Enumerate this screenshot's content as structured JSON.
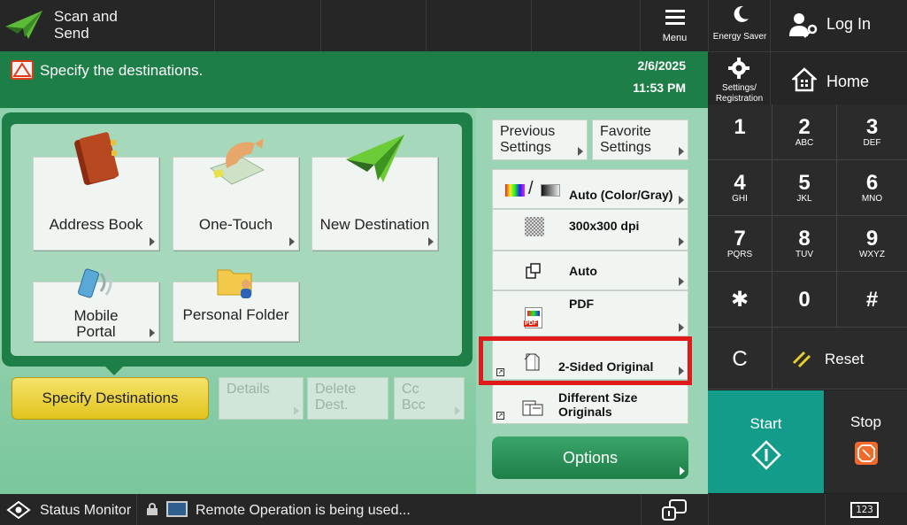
{
  "topbar": {
    "app_title_line1": "Scan and",
    "app_title_line2": "Send",
    "menu_label": "Menu",
    "energy_label": "Energy Saver",
    "login_label": "Log In",
    "settings_label_line1": "Settings/",
    "settings_label_line2": "Registration",
    "home_label": "Home"
  },
  "header": {
    "message": "Specify the destinations.",
    "date": "2/6/2025",
    "time": "11:53 PM"
  },
  "destinations": {
    "tiles": [
      {
        "label": "Address Book"
      },
      {
        "label": "One-Touch"
      },
      {
        "label": "New Destination"
      },
      {
        "label_line1": "Mobile",
        "label_line2": "Portal"
      },
      {
        "label": "Personal Folder"
      }
    ],
    "specify_label": "Specify Destinations",
    "details_label": "Details",
    "delete_line1": "Delete",
    "delete_line2": "Dest.",
    "cc_line1": "Cc",
    "cc_line2": "Bcc"
  },
  "settings": {
    "previous_line1": "Previous",
    "previous_line2": "Settings",
    "favorite_line1": "Favorite",
    "favorite_line2": "Settings",
    "color": "Auto (Color/Gray)",
    "resolution": "300x300 dpi",
    "size": "Auto",
    "format": "PDF",
    "format_icon_text": "PDF",
    "sided": "2-Sided Original",
    "diff_size": "Different Size Originals",
    "options": "Options"
  },
  "keypad": {
    "keys": [
      {
        "d": "1",
        "s": ""
      },
      {
        "d": "2",
        "s": "ABC"
      },
      {
        "d": "3",
        "s": "DEF"
      },
      {
        "d": "4",
        "s": "GHI"
      },
      {
        "d": "5",
        "s": "JKL"
      },
      {
        "d": "6",
        "s": "MNO"
      },
      {
        "d": "7",
        "s": "PQRS"
      },
      {
        "d": "8",
        "s": "TUV"
      },
      {
        "d": "9",
        "s": "WXYZ"
      },
      {
        "d": "✱",
        "s": ""
      },
      {
        "d": "0",
        "s": ""
      },
      {
        "d": "#",
        "s": ""
      }
    ],
    "clear": "C",
    "reset": "Reset",
    "start": "Start",
    "stop": "Stop"
  },
  "status": {
    "monitor": "Status Monitor",
    "message": "Remote Operation is being used...",
    "counter": "123"
  },
  "colors": {
    "green_dark": "#1d7f47",
    "panel_green": "#a6d8bb",
    "start_teal": "#149c8a",
    "highlight_red": "#e01a1a",
    "yellow": "#e9cf2e"
  }
}
